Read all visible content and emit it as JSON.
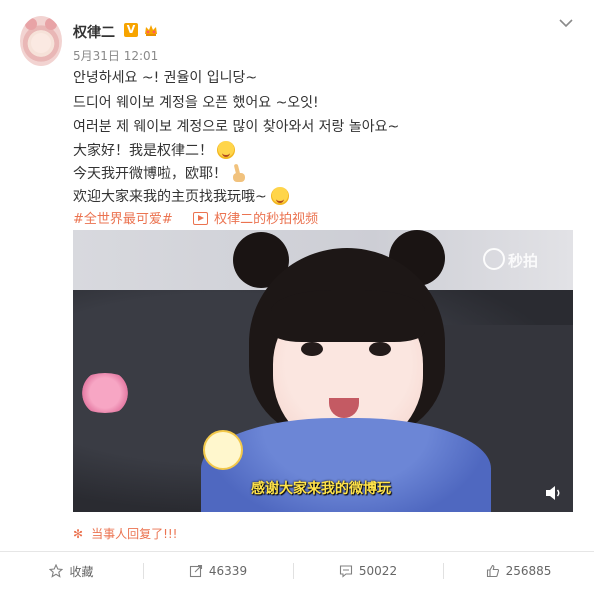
{
  "post": {
    "author": "权律二",
    "time": "5月31日 12:01",
    "lines": [
      "안녕하세요 ~! 권율이 입니당~",
      "드디어 웨이보 계정을 오픈 했어요 ~오잇!",
      "여러분 제 웨이보 계정으로 많이 찾아와서 저랑 놀아요~",
      "大家好！我是权律二！",
      "今天我开微博啦，欧耶！",
      "欢迎大家来我的主页找我玩哦~"
    ],
    "hashtag": "#全世界最可爱#",
    "video_link": "权律二的秒拍视频"
  },
  "video": {
    "watermark": "秒拍",
    "subtitle": "感谢大家来我的微博玩"
  },
  "reply_notice": "当事人回复了!!!",
  "toolbar": {
    "favorite_label": "收藏",
    "repost_count": "46339",
    "comment_count": "50022",
    "like_count": "256885"
  },
  "colors": {
    "link": "#eb7350",
    "vip": "#f7a400"
  }
}
